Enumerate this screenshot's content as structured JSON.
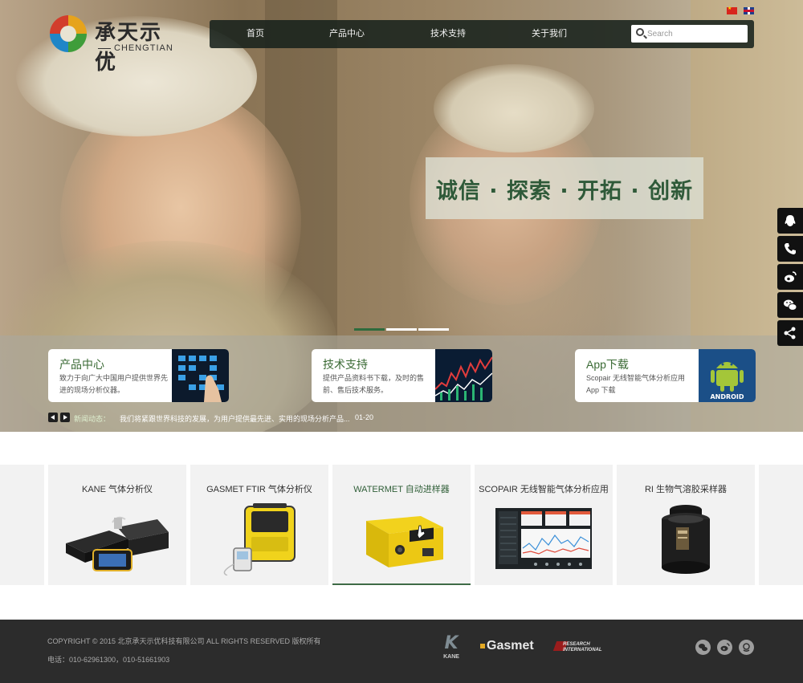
{
  "brand": {
    "name_cn": "承天示优",
    "name_en": "CHENGTIAN"
  },
  "nav": {
    "items": [
      "首页",
      "产品中心",
      "技术支持",
      "关于我们"
    ],
    "search_placeholder": "Search"
  },
  "languages": [
    {
      "name": "中文",
      "icon": "china-flag-icon"
    },
    {
      "name": "English",
      "icon": "uk-flag-icon"
    }
  ],
  "hero": {
    "slogan": "诚信 · 探索 · 开拓 · 创新",
    "slide_count": 3,
    "active_slide": 1
  },
  "cards": [
    {
      "title": "产品中心",
      "desc": "致力于向广大中国用户提供世界先进的现场分析仪器。",
      "thumb_icon": "touchscreen-thumb"
    },
    {
      "title": "技术支持",
      "desc": "提供产品资料书下载，及时的售前、售后技术服务。",
      "thumb_icon": "stock-chart-thumb"
    },
    {
      "title": "App下载",
      "desc": "Scopair 无线智能气体分析应用 App 下载",
      "thumb_icon": "android-thumb"
    }
  ],
  "news": {
    "label": "新闻动态：",
    "text": "我们将紧跟世界科技的发展，为用户提供最先进、实用的现场分析产品...",
    "date": "01-20"
  },
  "side_tools": [
    "qq-icon",
    "phone-icon",
    "weibo-icon",
    "wechat-icon",
    "share-icon"
  ],
  "products": [
    {
      "title": "KANE 气体分析仪",
      "image": "kane-analyzer"
    },
    {
      "title": "GASMET FTIR 气体分析仪",
      "image": "gasmet-ftir"
    },
    {
      "title": "WATERMET 自动进样器",
      "image": "watermet-sampler",
      "active": true
    },
    {
      "title": "SCOPAIR 无线智能气体分析应用",
      "image": "scopair-app"
    },
    {
      "title": "RI 生物气溶胶采样器",
      "image": "ri-sampler"
    }
  ],
  "footer": {
    "copyright": "COPYRIGHT © 2015 北京承天示优科技有限公司 ALL RIGHTS RESERVED 版权所有",
    "phone": "电话：010-62961300，010-51661903",
    "partners": {
      "kane": "KANE",
      "gasmet": "Gasmet",
      "ri_line1": "RESEARCH",
      "ri_line2": "INTERNATIONAL"
    },
    "social": [
      "wechat-icon",
      "weibo-icon",
      "qq-circle-icon"
    ]
  },
  "colors": {
    "accent_green": "#2e6b3d",
    "nav_bg": "#18221c",
    "footer_bg": "#2c2c2c"
  }
}
